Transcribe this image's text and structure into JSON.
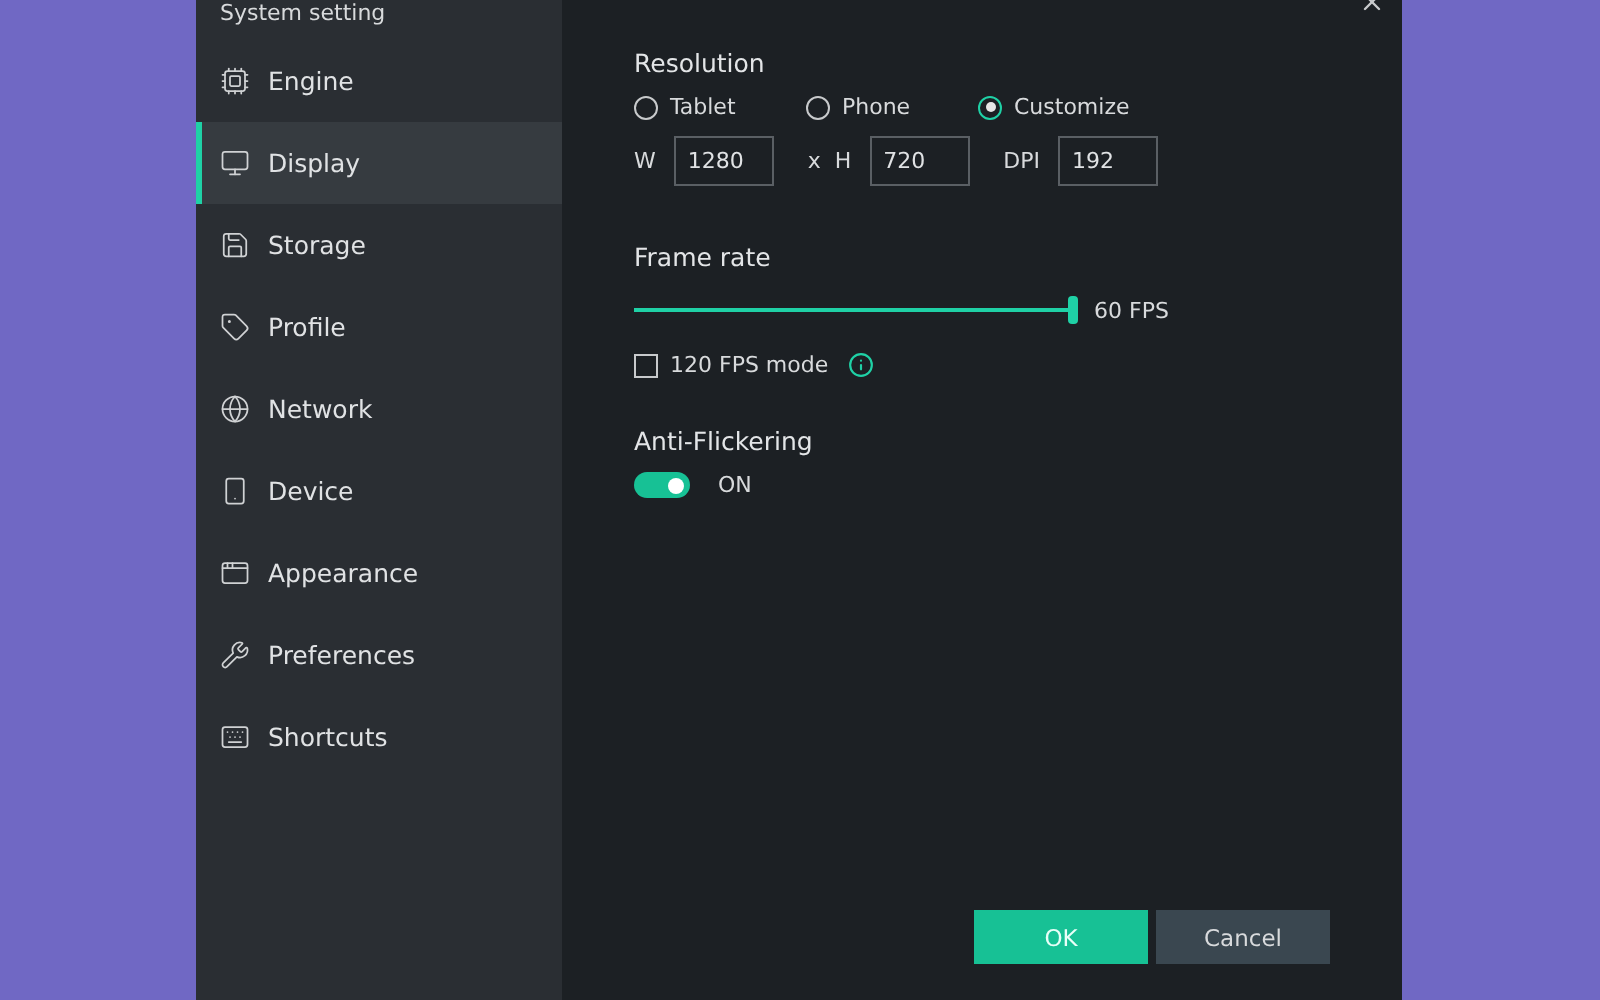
{
  "window": {
    "title": "System setting"
  },
  "sidebar": {
    "items": [
      {
        "label": "Engine",
        "selected": false
      },
      {
        "label": "Display",
        "selected": true
      },
      {
        "label": "Storage",
        "selected": false
      },
      {
        "label": "Profile",
        "selected": false
      },
      {
        "label": "Network",
        "selected": false
      },
      {
        "label": "Device",
        "selected": false
      },
      {
        "label": "Appearance",
        "selected": false
      },
      {
        "label": "Preferences",
        "selected": false
      },
      {
        "label": "Shortcuts",
        "selected": false
      }
    ]
  },
  "resolution": {
    "title": "Resolution",
    "options": [
      {
        "label": "Tablet",
        "selected": false
      },
      {
        "label": "Phone",
        "selected": false
      },
      {
        "label": "Customize",
        "selected": true
      }
    ],
    "fields": [
      {
        "label": "W",
        "value": "1280"
      },
      {
        "label": "x  H",
        "value": "720"
      },
      {
        "label": "DPI",
        "value": "192"
      }
    ]
  },
  "frame_rate": {
    "title": "Frame rate",
    "level": 1,
    "reading": "60 FPS",
    "mode": {
      "label": "120 FPS mode",
      "checked": false
    }
  },
  "anti_flickering": {
    "title": "Anti-Flickering",
    "on": true,
    "state_label": "ON"
  },
  "buttons": [
    {
      "label": "OK",
      "kind": "primary"
    },
    {
      "label": "Cancel",
      "kind": "secondary"
    }
  ]
}
